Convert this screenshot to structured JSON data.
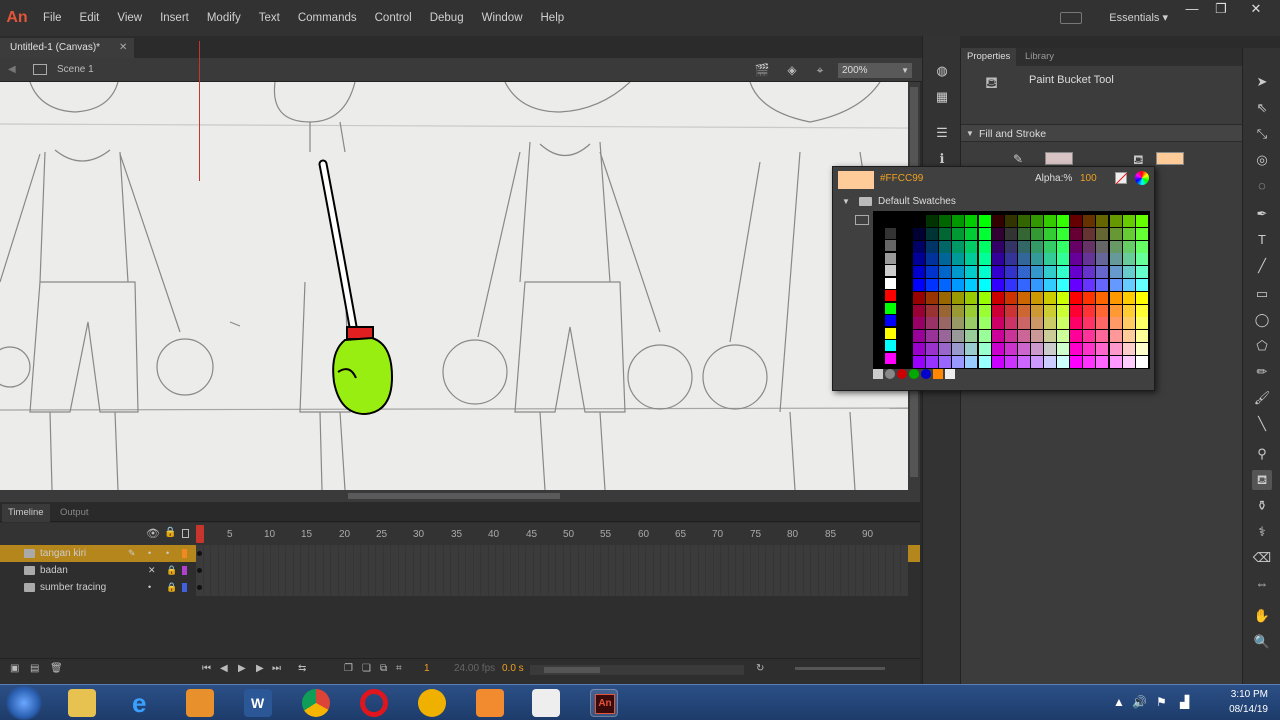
{
  "app": {
    "logo": "An",
    "menu": [
      "File",
      "Edit",
      "View",
      "Insert",
      "Modify",
      "Text",
      "Commands",
      "Control",
      "Debug",
      "Window",
      "Help"
    ],
    "workspace": "Essentials ▾",
    "window_controls": [
      "—",
      "❐",
      "✕"
    ]
  },
  "document": {
    "tab_title": "Untitled-1 (Canvas)*",
    "tab_close": "✕",
    "scene": "Scene 1",
    "zoom": "200%"
  },
  "properties": {
    "tabs": [
      "Properties",
      "Library"
    ],
    "tool_name": "Paint Bucket Tool",
    "section": "Fill and Stroke",
    "fill_color": "#FFCC99"
  },
  "swatch_popup": {
    "hex": "#FFCC99",
    "alpha_label": "Alpha:%",
    "alpha_value": "100",
    "folder": "Default Swatches"
  },
  "timeline": {
    "tabs": [
      "Timeline",
      "Output"
    ],
    "frame_numbers": [
      "1",
      "5",
      "10",
      "15",
      "20",
      "25",
      "30",
      "35",
      "40",
      "45",
      "50",
      "55",
      "60",
      "65",
      "70",
      "75",
      "80",
      "85",
      "90"
    ],
    "layers": [
      {
        "name": "tangan kiri",
        "color": "#f08a20",
        "selected": true
      },
      {
        "name": "badan",
        "color": "#b040d0",
        "selected": false
      },
      {
        "name": "sumber tracing",
        "color": "#4060e0",
        "selected": false
      }
    ],
    "current_frame": "1",
    "fps": "24.00 fps",
    "time": "0.0 s"
  },
  "taskbar": {
    "time": "3:10 PM",
    "date": "08/14/19"
  }
}
